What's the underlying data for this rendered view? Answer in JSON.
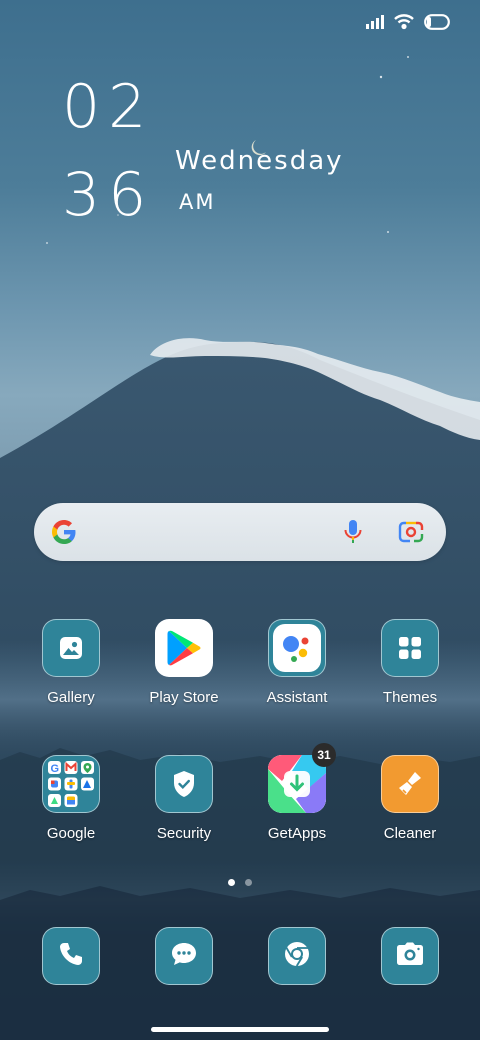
{
  "clock": {
    "hour": "02",
    "minute": "36",
    "weekday": "Wednesday",
    "ampm": "AM"
  },
  "status_icons": [
    "signal-icon",
    "wifi-icon",
    "battery-icon"
  ],
  "search": {
    "icons": [
      "google-g-icon",
      "mic-icon",
      "google-lens-icon"
    ]
  },
  "apps_row1": [
    {
      "label": "Gallery",
      "icon": "gallery-icon"
    },
    {
      "label": "Play Store",
      "icon": "play-store-icon"
    },
    {
      "label": "Assistant",
      "icon": "assistant-icon"
    },
    {
      "label": "Themes",
      "icon": "themes-icon"
    }
  ],
  "apps_row2": [
    {
      "label": "Google",
      "icon": "google-folder-icon"
    },
    {
      "label": "Security",
      "icon": "shield-icon"
    },
    {
      "label": "GetApps",
      "icon": "getapps-icon",
      "badge": "31"
    },
    {
      "label": "Cleaner",
      "icon": "cleaner-icon"
    }
  ],
  "dock": [
    "phone-icon",
    "messages-icon",
    "chrome-icon",
    "camera-icon"
  ],
  "page_indicator": {
    "pages": 2,
    "current": 1
  },
  "colors": {
    "tile": "#2f8499",
    "cleaner": "#f29a30",
    "text": "#ffffff"
  }
}
